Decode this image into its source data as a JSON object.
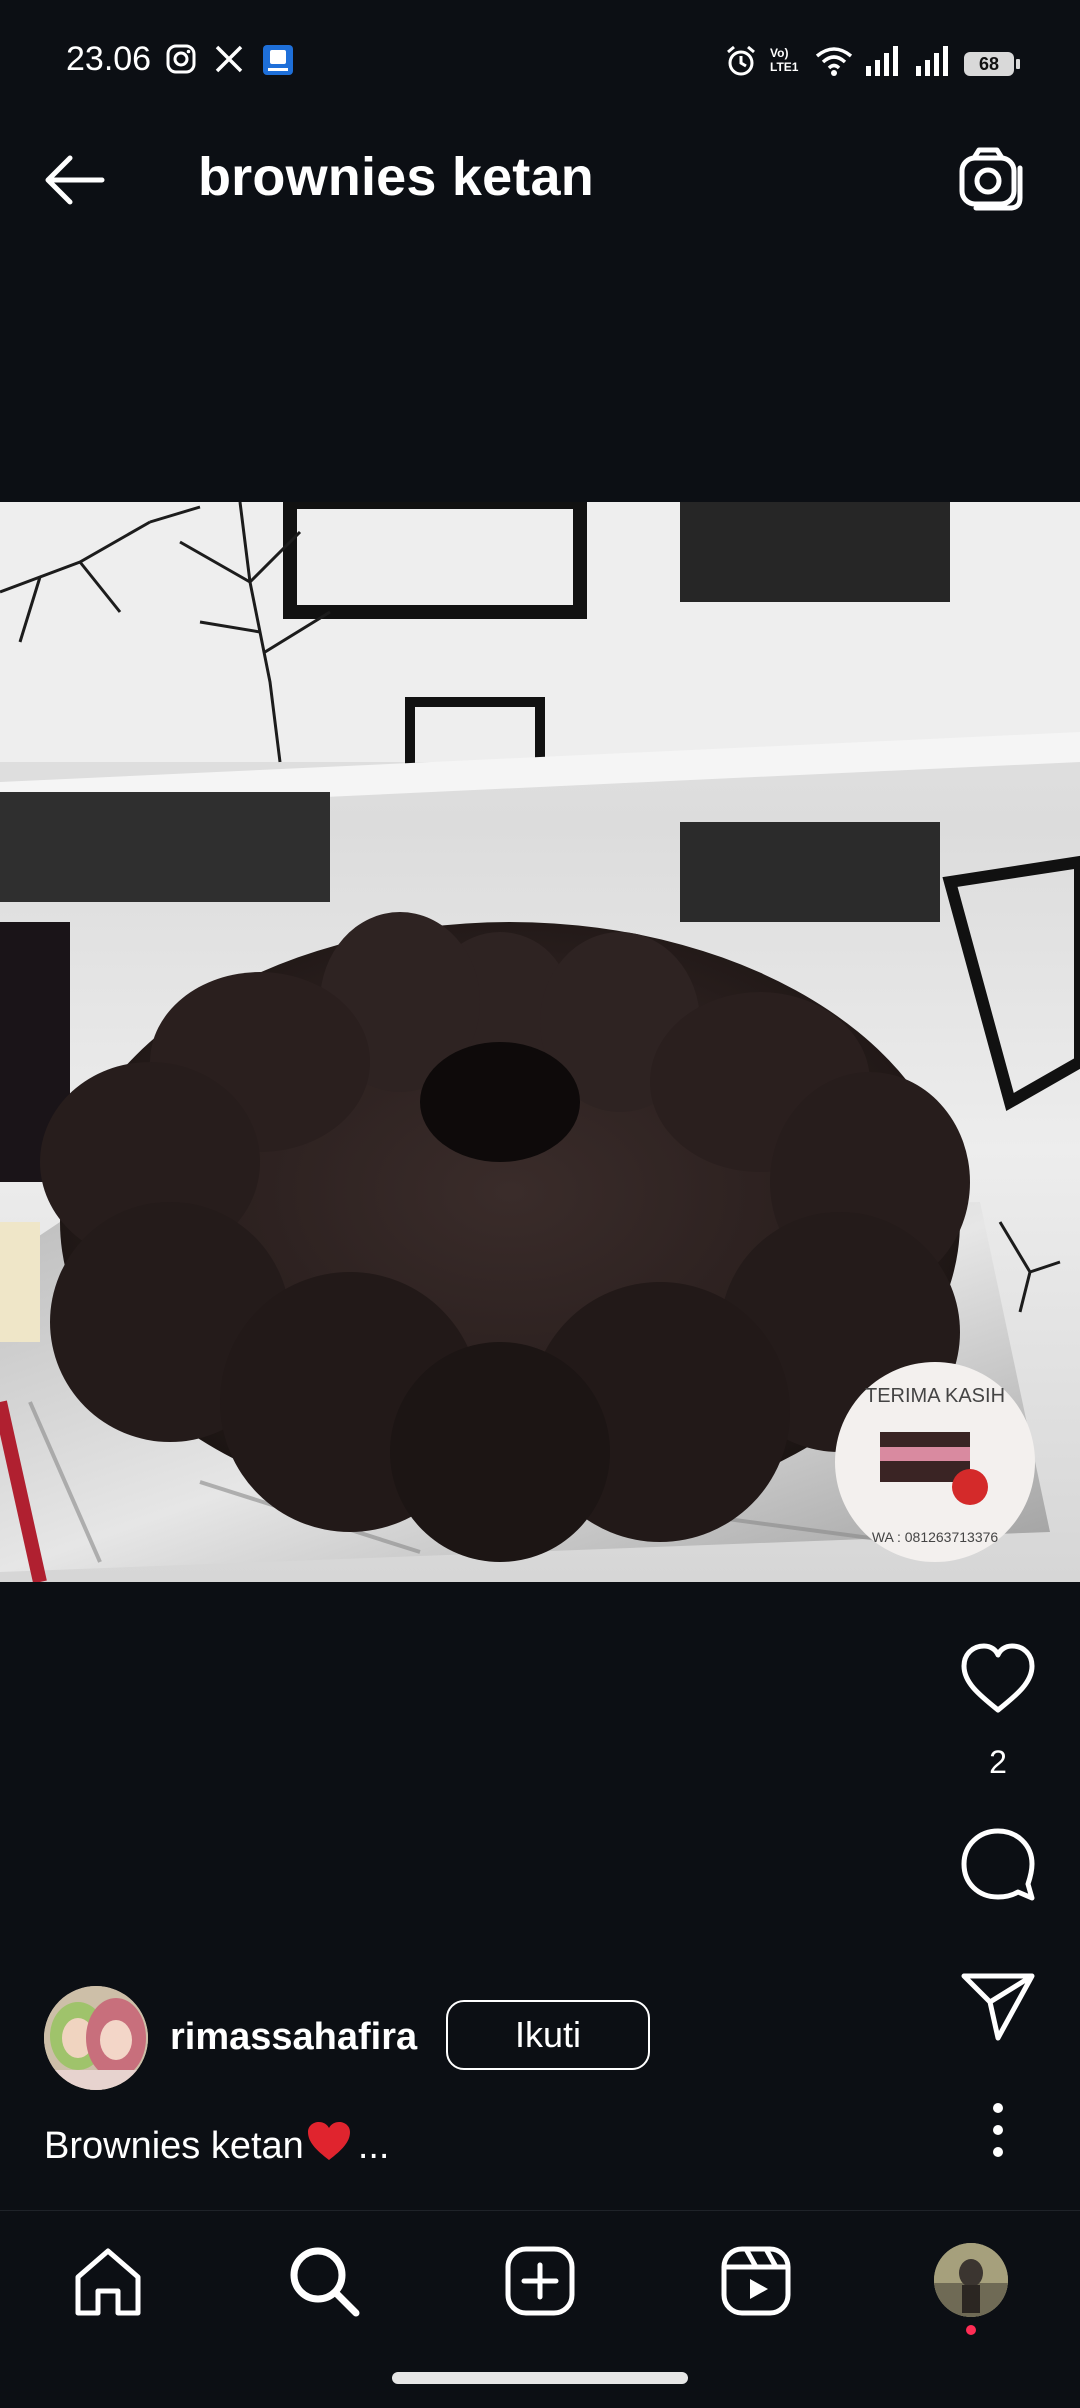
{
  "status_bar": {
    "time": "23.06",
    "network": "Vo) LTE1",
    "battery": "68"
  },
  "header": {
    "title": "brownies ketan"
  },
  "post": {
    "sticker_text_top": "TERIMA KASIH",
    "sticker_text_bottom": "WA : 081263713376",
    "like_count": "2",
    "author": {
      "username": "rimassahafira",
      "follow_label": "Ikuti"
    },
    "caption": {
      "text": "Brownies ketan",
      "more": "..."
    }
  },
  "icons": {
    "back": "arrow-left-icon",
    "camera": "camera-icon",
    "like": "heart-icon",
    "comment": "comment-bubble-icon",
    "share": "paper-plane-icon",
    "more": "more-vertical-icon",
    "nav": [
      "home-icon",
      "search-icon",
      "create-icon",
      "reels-icon",
      "profile-avatar"
    ]
  },
  "colors": {
    "background": "#0c0f14",
    "text": "#ffffff",
    "notification": "#ff2d55",
    "emoji_heart": "#e0242e"
  }
}
